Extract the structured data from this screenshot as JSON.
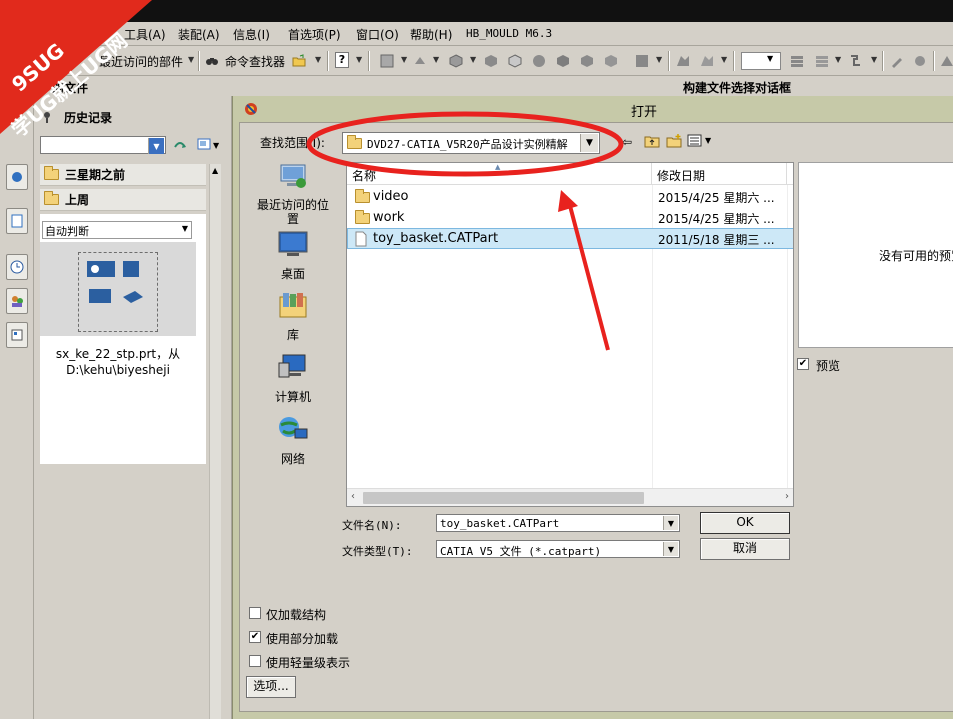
{
  "watermark": {
    "line1": "9SUG",
    "line2": "学UG就上UG网"
  },
  "menubar": {
    "items": [
      "工具(A)",
      "装配(A)",
      "信息(I)",
      "首选项(P)",
      "窗口(O)",
      "帮助(H)"
    ],
    "mould": "HB_MOULD M6.3"
  },
  "toolbar": {
    "recent_parts": "最近访问的部件",
    "command_finder": "命令查找器"
  },
  "header": {
    "left_title": "的文件",
    "right_title": "构建文件选择对话框"
  },
  "history": {
    "title": "历史记录",
    "section_three_weeks": "三星期之前",
    "section_last_week": "上周",
    "auto_judge": "自动判断",
    "file_name": "sx_ke_22_stp.prt，从",
    "file_path": "D:\\kehu\\biyesheji"
  },
  "dialog": {
    "title": "打开",
    "look_in_label": "查找范围(I):",
    "look_in_value": "DVD27-CATIA_V5R20产品设计实例精解",
    "places": [
      "最近访问的位置",
      "桌面",
      "库",
      "计算机",
      "网络"
    ],
    "columns": {
      "name": "名称",
      "date": "修改日期"
    },
    "files": [
      {
        "name": "video",
        "date": "2015/4/25 星期六 ...",
        "type": "folder"
      },
      {
        "name": "work",
        "date": "2015/4/25 星期六 ...",
        "type": "folder"
      },
      {
        "name": "toy_basket.CATPart",
        "date": "2011/5/18 星期三 ...",
        "type": "file"
      }
    ],
    "preview_text": "没有可用的预览",
    "preview_label": "预览",
    "filename_label": "文件名(N):",
    "filename_value": "toy_basket.CATPart",
    "filetype_label": "文件类型(T):",
    "filetype_value": "CATIA V5 文件 (*.catpart)",
    "ok_label": "OK",
    "cancel_label": "取消",
    "opt_structure": "仅加载结构",
    "opt_partial": "使用部分加载",
    "opt_lightweight": "使用轻量级表示",
    "options_label": "选项..."
  },
  "colors": {
    "annotation_red": "#e8221e",
    "dialog_olive": "#c6c9a8",
    "selected_row": "#cde8f7"
  }
}
